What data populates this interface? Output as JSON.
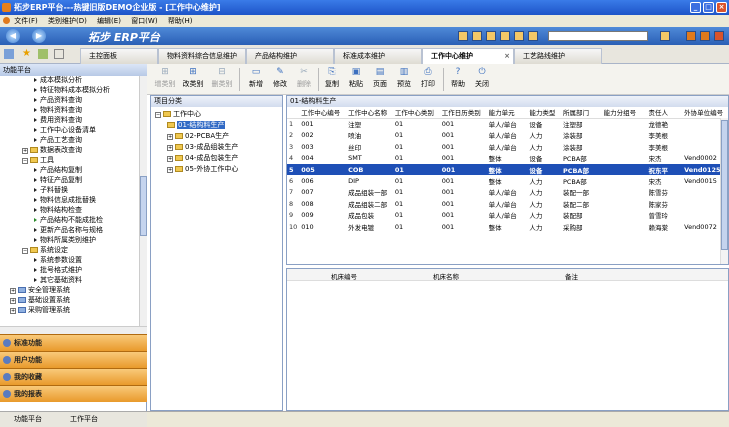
{
  "window": {
    "title": "拓步ERP平台---热键旧版DEMO企业版 - [工作中心维护]",
    "min": "_",
    "max": "□",
    "close": "×"
  },
  "menu": [
    {
      "label": "文件(F)"
    },
    {
      "label": "类别维护(D)"
    },
    {
      "label": "编辑(E)"
    },
    {
      "label": "窗口(W)"
    },
    {
      "label": "帮助(H)"
    }
  ],
  "nav": {
    "back": "◀",
    "forward": "▶",
    "logo": "拓步 ERP平台",
    "search_value": ""
  },
  "tabs": [
    {
      "label": "主控面板"
    },
    {
      "label": "物料资料综合信息维护"
    },
    {
      "label": "产品结构维护"
    },
    {
      "label": "标准成本维护"
    },
    {
      "label": "工作中心维护",
      "close": "×"
    },
    {
      "label": "工艺路线维护"
    }
  ],
  "left": {
    "header": "功能平台",
    "tree": [
      {
        "label": "成本模拟分析",
        "kind": "leaf"
      },
      {
        "label": "特征物料成本模拟分析",
        "kind": "leaf"
      },
      {
        "label": "产品资料查询",
        "kind": "leaf"
      },
      {
        "label": "物料资料查询",
        "kind": "leaf"
      },
      {
        "label": "费用资料查询",
        "kind": "leaf"
      },
      {
        "label": "工作中心设备清单",
        "kind": "leaf"
      },
      {
        "label": "产品工艺查询",
        "kind": "leaf"
      },
      {
        "label": "数据表改查询",
        "kind": "folder",
        "pm": "+"
      },
      {
        "label": "工具",
        "kind": "folder",
        "pm": "−"
      },
      {
        "label": "产品结构复制",
        "kind": "leaf"
      },
      {
        "label": "特征产品复制",
        "kind": "leaf"
      },
      {
        "label": "子料替换",
        "kind": "leaf"
      },
      {
        "label": "物料信息成批替换",
        "kind": "leaf"
      },
      {
        "label": "物料结构检查",
        "kind": "leaf"
      },
      {
        "label": "产品结构不能成批检",
        "kind": "leaf"
      },
      {
        "label": "更新产品名称与规格",
        "kind": "leaf"
      },
      {
        "label": "物料所属类别维护",
        "kind": "leaf"
      },
      {
        "label": "系统设定",
        "kind": "folder",
        "pm": "−"
      },
      {
        "label": "系统参数设置",
        "kind": "leaf"
      },
      {
        "label": "批号格式维护",
        "kind": "leaf"
      },
      {
        "label": "其它基础资料",
        "kind": "leaf"
      },
      {
        "label": "安全管理系统",
        "kind": "folder",
        "pm": "+"
      },
      {
        "label": "基础设置系统",
        "kind": "folder",
        "pm": "+"
      },
      {
        "label": "采购管理系统",
        "kind": "folder",
        "pm": "+"
      }
    ],
    "sections": [
      {
        "label": "标准功能"
      },
      {
        "label": "用户功能"
      },
      {
        "label": "我的收藏"
      },
      {
        "label": "我的报表"
      }
    ],
    "bottom_tabs": [
      {
        "label": "功能平台"
      },
      {
        "label": "工作平台"
      }
    ]
  },
  "toolbar": [
    {
      "label": "增类别",
      "glyph": "⊞",
      "enabled": false
    },
    {
      "label": "改类别",
      "glyph": "⊞",
      "enabled": true
    },
    {
      "label": "删类别",
      "glyph": "⊟",
      "enabled": false
    },
    {
      "label": "新增",
      "glyph": "▭",
      "enabled": true
    },
    {
      "label": "修改",
      "glyph": "✎",
      "enabled": true
    },
    {
      "label": "删除",
      "glyph": "✂",
      "enabled": false
    },
    {
      "label": "复制",
      "glyph": "⎘",
      "enabled": true
    },
    {
      "label": "粘贴",
      "glyph": "▣",
      "enabled": true
    },
    {
      "label": "页面",
      "glyph": "▤",
      "enabled": true
    },
    {
      "label": "预览",
      "glyph": "▥",
      "enabled": true
    },
    {
      "label": "打印",
      "glyph": "⎙",
      "enabled": true
    },
    {
      "label": "帮助",
      "glyph": "?",
      "enabled": true
    },
    {
      "label": "关闭",
      "glyph": "⏻",
      "enabled": true
    }
  ],
  "category": {
    "header": "项目分类",
    "root": "工作中心",
    "items": [
      {
        "label": "01-结构料生产",
        "selected": true
      },
      {
        "label": "02-PCBA生产",
        "selected": false
      },
      {
        "label": "03-成品组装生产",
        "selected": false
      },
      {
        "label": "04-成品包装生产",
        "selected": false
      },
      {
        "label": "05-外协工作中心",
        "selected": false
      }
    ]
  },
  "grid": {
    "header": "01-结构料生产",
    "columns": [
      "",
      "工作中心编号",
      "工作中心名称",
      "工作中心类别",
      "工作日历类别",
      "能力单元",
      "能力类型",
      "所属部门",
      "能力分组号",
      "责任人",
      "外协单位编号"
    ],
    "rows": [
      [
        "1",
        "001",
        "注塑",
        "01",
        "001",
        "单人/单台",
        "设备",
        "注塑部",
        "",
        "龙德艳",
        ""
      ],
      [
        "2",
        "002",
        "喷油",
        "01",
        "001",
        "单人/单台",
        "人力",
        "涂装部",
        "",
        "李美根",
        ""
      ],
      [
        "3",
        "003",
        "丝印",
        "01",
        "001",
        "单人/单台",
        "人力",
        "涂装部",
        "",
        "李美根",
        ""
      ],
      [
        "4",
        "004",
        "SMT",
        "01",
        "001",
        "整体",
        "设备",
        "PCBA部",
        "",
        "宋杰",
        "Vend0002"
      ],
      [
        "5",
        "005",
        "COB",
        "01",
        "001",
        "整体",
        "设备",
        "PCBA部",
        "",
        "祝东平",
        "Vend0125"
      ],
      [
        "6",
        "006",
        "DIP",
        "01",
        "001",
        "整体",
        "人力",
        "PCBA部",
        "",
        "宋杰",
        "Vend0015"
      ],
      [
        "7",
        "007",
        "成品组装一部",
        "01",
        "001",
        "单人/单台",
        "人力",
        "装配一部",
        "",
        "陈雪芬",
        ""
      ],
      [
        "8",
        "008",
        "成品组装二部",
        "01",
        "001",
        "单人/单台",
        "人力",
        "装配二部",
        "",
        "陈家芬",
        ""
      ],
      [
        "9",
        "009",
        "成品包装",
        "01",
        "001",
        "单人/单台",
        "人力",
        "装配部",
        "",
        "曾雪玲",
        ""
      ],
      [
        "10",
        "010",
        "外发电镀",
        "01",
        "001",
        "整体",
        "人力",
        "采购部",
        "",
        "赖海棠",
        "Vend0072"
      ]
    ],
    "selected_row": 4
  },
  "detail": {
    "columns": [
      "机床编号",
      "机床名称",
      "备注"
    ]
  },
  "colors": {
    "accent": "#1e4fb6",
    "title": "#1d54c8",
    "section": "#e99a2c"
  }
}
